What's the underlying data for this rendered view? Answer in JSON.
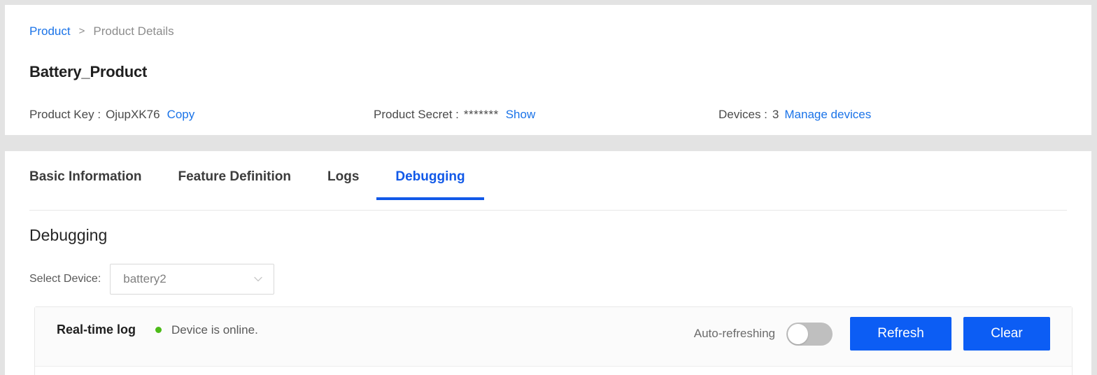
{
  "breadcrumb": {
    "root": "Product",
    "separator": ">",
    "current": "Product Details"
  },
  "product": {
    "title": "Battery_Product",
    "key_label": "Product Key :",
    "key_value": "OjupXK76",
    "key_action": "Copy",
    "secret_label": "Product Secret :",
    "secret_value": "*******",
    "secret_action": "Show",
    "devices_label": "Devices :",
    "devices_value": "3",
    "devices_action": "Manage devices"
  },
  "tabs": [
    {
      "label": "Basic Information",
      "active": false
    },
    {
      "label": "Feature Definition",
      "active": false
    },
    {
      "label": "Logs",
      "active": false
    },
    {
      "label": "Debugging",
      "active": true
    }
  ],
  "section": {
    "title": "Debugging",
    "device_label": "Select Device:",
    "device_selected": "battery2"
  },
  "log_panel": {
    "title": "Real-time log",
    "status_text": "Device is online.",
    "status_color": "#4cbb18",
    "auto_refresh_label": "Auto-refreshing",
    "auto_refresh_on": false,
    "refresh_label": "Refresh",
    "clear_label": "Clear"
  },
  "colors": {
    "link_blue": "#1a73e8",
    "tab_active_blue": "#1159e8",
    "button_blue": "#0c5df4",
    "page_background": "#e3e3e3",
    "card_background": "#ffffff",
    "panel_header_background": "#fbfbfb",
    "toggle_off_track": "#bfbfbf"
  }
}
